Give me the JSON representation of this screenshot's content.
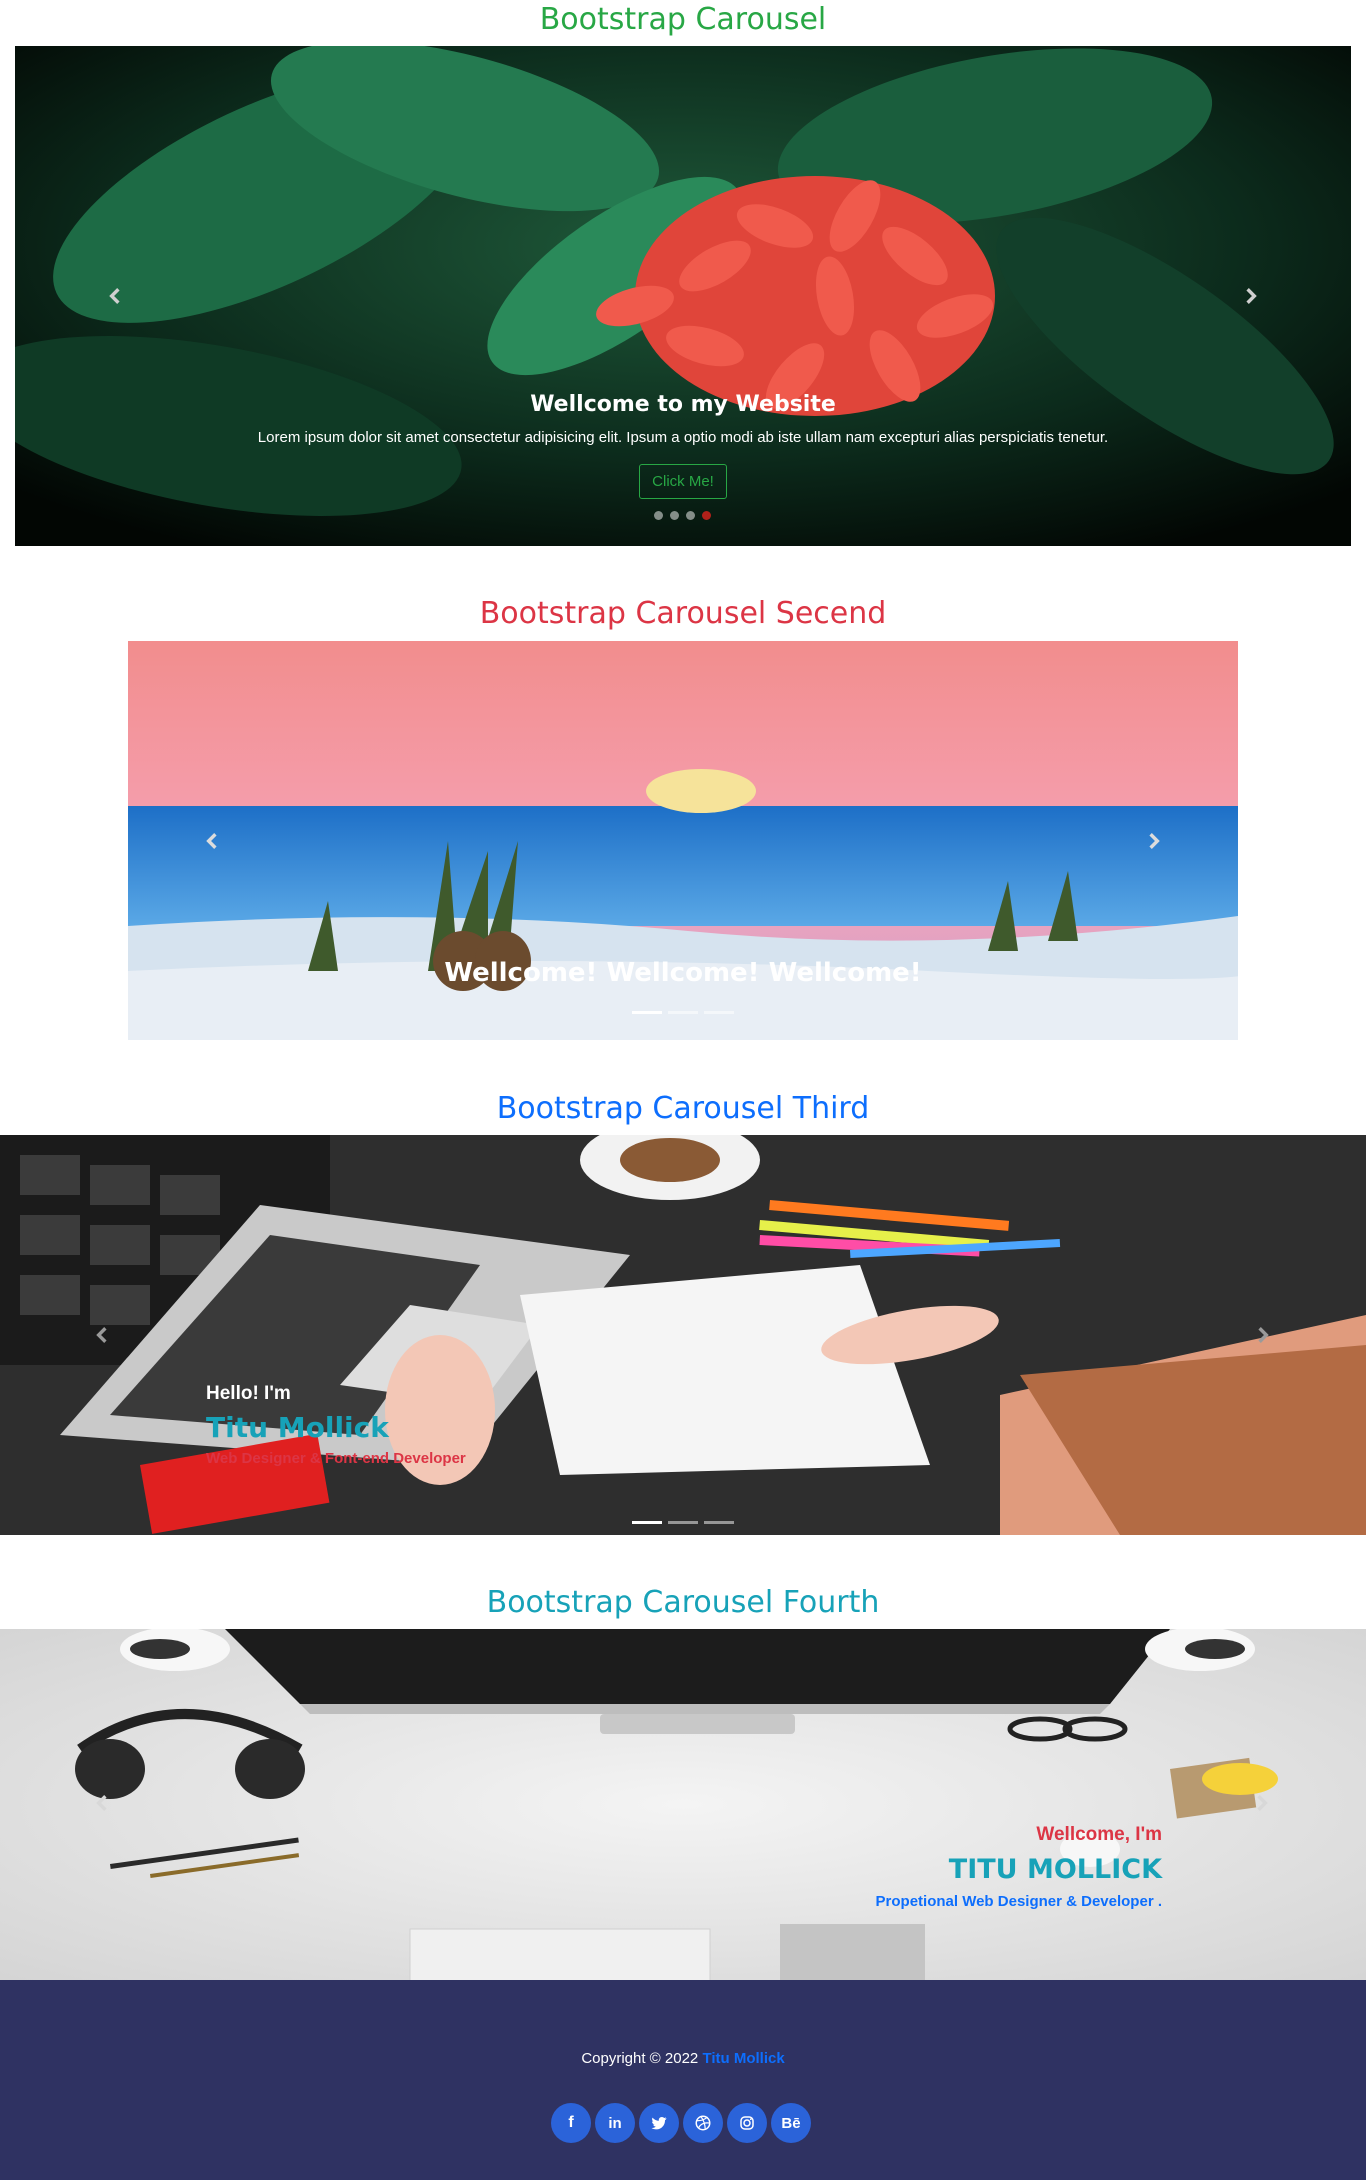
{
  "carousel1": {
    "title": "Bootstrap Carousel",
    "title_color": "#28a745",
    "heading": "Wellcome to my Website",
    "text": "Lorem ipsum dolor sit amet consectetur adipisicing elit. Ipsum a optio modi ab iste ullam nam excepturi alias perspiciatis tenetur.",
    "button_label": "Click Me!",
    "indicator_count": 4,
    "active_indicator": 4
  },
  "carousel2": {
    "title": "Bootstrap Carousel Secend",
    "title_color": "#dc3545",
    "caption": "Wellcome! Wellcome! Wellcome!",
    "indicator_count": 3,
    "active_indicator": 1
  },
  "carousel3": {
    "title": "Bootstrap Carousel Third",
    "title_color": "#0d6efd",
    "greeting": "Hello! I'm",
    "name": "Titu Mollick",
    "role": "Web Designer & Font-end Developer",
    "indicator_count": 3,
    "active_indicator": 1
  },
  "carousel4": {
    "title": "Bootstrap Carousel Fourth",
    "title_color": "#17a2b8",
    "greeting": "Wellcome, I'm",
    "name": "TITU MOLLICK",
    "role": "Propetional Web Designer & Developer",
    "role_suffix": "."
  },
  "footer": {
    "copyright": "Copyright © 2022",
    "author": "Titu Mollick",
    "social": [
      {
        "icon": "facebook-icon",
        "label": "f"
      },
      {
        "icon": "linkedin-icon",
        "label": "in"
      },
      {
        "icon": "twitter-icon",
        "label": ""
      },
      {
        "icon": "dribbble-icon",
        "label": ""
      },
      {
        "icon": "instagram-icon",
        "label": ""
      },
      {
        "icon": "behance-icon",
        "label": "Bē"
      }
    ]
  }
}
